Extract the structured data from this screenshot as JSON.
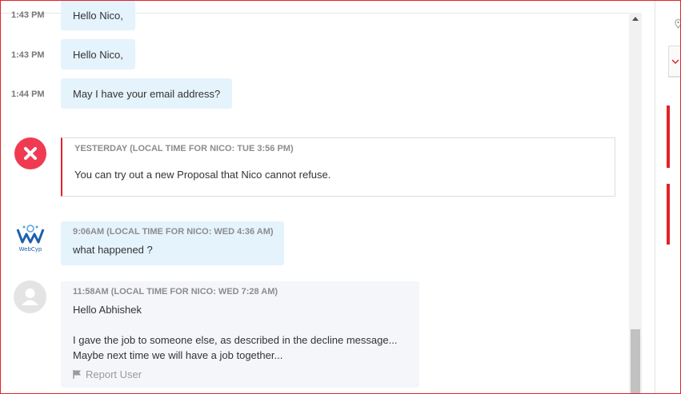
{
  "messages": [
    {
      "time": "1:43 PM",
      "text": "Hello Nico,"
    },
    {
      "time": "1:43 PM",
      "text": "Hello Nico,"
    },
    {
      "time": "1:44 PM",
      "text": "May I have your email address?"
    }
  ],
  "system_notice": {
    "meta": "YESTERDAY (LOCAL TIME FOR NICO: TUE 3:56 PM)",
    "text": "You can try out a new Proposal that Nico cannot refuse."
  },
  "reply": {
    "logo_text": "WebCyp",
    "meta": "9:06AM (LOCAL TIME FOR NICO: WED 4:36 AM)",
    "text": "what happened ?"
  },
  "client_message": {
    "meta": "11:58AM (LOCAL TIME FOR NICO: WED 7:28 AM)",
    "line1": "Hello Abhishek",
    "line2": "I gave the job to someone else, as described in the decline message...",
    "line3": "Maybe next time we will have a job together...",
    "report_label": "Report User"
  },
  "colors": {
    "accent_red": "#e2232a",
    "bubble_blue": "#e5f3fd",
    "bubble_grey": "#f5f6fa"
  }
}
